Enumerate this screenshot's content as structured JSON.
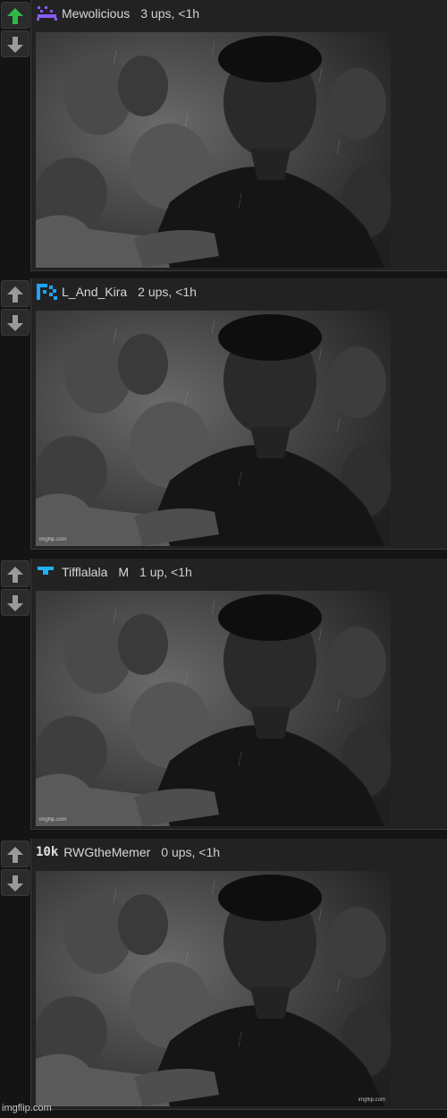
{
  "comments": [
    {
      "username": "Mewolicious",
      "flair": "",
      "badge_icon": "purple-invader-icon",
      "badge_text": "",
      "meta": "3 ups, <1h",
      "upvoted": true,
      "image_watermark": ""
    },
    {
      "username": "L_And_Kira",
      "flair": "",
      "badge_icon": "blue-pixel-icon",
      "badge_text": "",
      "meta": "2 ups, <1h",
      "upvoted": false,
      "image_watermark": "imgflip.com"
    },
    {
      "username": "Tifflalala",
      "flair": "M",
      "badge_icon": "blue-t-icon",
      "badge_text": "",
      "meta": "1 up, <1h",
      "upvoted": false,
      "image_watermark": "imgflip.com"
    },
    {
      "username": "RWGtheMemer",
      "flair": "",
      "badge_icon": "10k-badge-icon",
      "badge_text": "10k",
      "meta": "0 ups, <1h",
      "upvoted": false,
      "image_watermark": "imgflip.com"
    }
  ],
  "footer": {
    "watermark": "imgflip.com"
  },
  "colors": {
    "upvote_active": "#2fb84a",
    "vote_inactive": "#9a9a9a",
    "background": "#141414",
    "panel": "#222222"
  }
}
